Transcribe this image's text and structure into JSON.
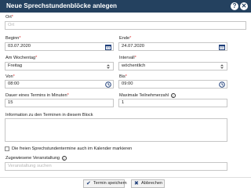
{
  "dialog": {
    "title": "Neue Sprechstundenblöcke anlegen",
    "help_icon": "question-icon",
    "close_icon": "close-icon"
  },
  "form": {
    "ort": {
      "label": "Ort",
      "required_mark": "*",
      "placeholder": "Ort"
    },
    "beginn": {
      "label": "Beginn",
      "required_mark": "*",
      "value": "03.07.2020",
      "icon": "calendar-icon"
    },
    "ende": {
      "label": "Ende",
      "required_mark": "*",
      "value": "24.07.2020",
      "icon": "calendar-icon"
    },
    "wochentag": {
      "label": "Am Wochentag",
      "required_mark": "*",
      "value": "Freitag",
      "icon": "select-arrows-icon"
    },
    "intervall": {
      "label": "Intervall",
      "required_mark": "*",
      "value": "wöchentlich",
      "icon": "select-arrows-icon"
    },
    "von": {
      "label": "Von",
      "required_mark": "*",
      "value": "08:00",
      "icon": "clock-icon"
    },
    "bis": {
      "label": "Bis",
      "required_mark": "*",
      "value": "09:00",
      "icon": "clock-icon"
    },
    "dauer": {
      "label": "Dauer eines Termins in Minuten",
      "required_mark": "*",
      "value": "15"
    },
    "teilnehmer": {
      "label": "Maximale Teilnehmerzahl",
      "value": "1",
      "info": "i"
    },
    "information": {
      "label": "Information zu den Terminen in diesem Block"
    },
    "kalender": {
      "label": "Die freien Sprechstundentermine auch im Kalender markieren",
      "checked": false
    },
    "veranstaltung": {
      "label": "Zugewiesene Veranstaltung",
      "info": "i",
      "placeholder": "Veranstaltung suchen"
    }
  },
  "footer": {
    "save_label": "Termin speichern",
    "cancel_label": "Abbrechen"
  },
  "colors": {
    "titlebar": "#24415f",
    "required": "#d33333",
    "button_icon": "#1f3f7a"
  }
}
